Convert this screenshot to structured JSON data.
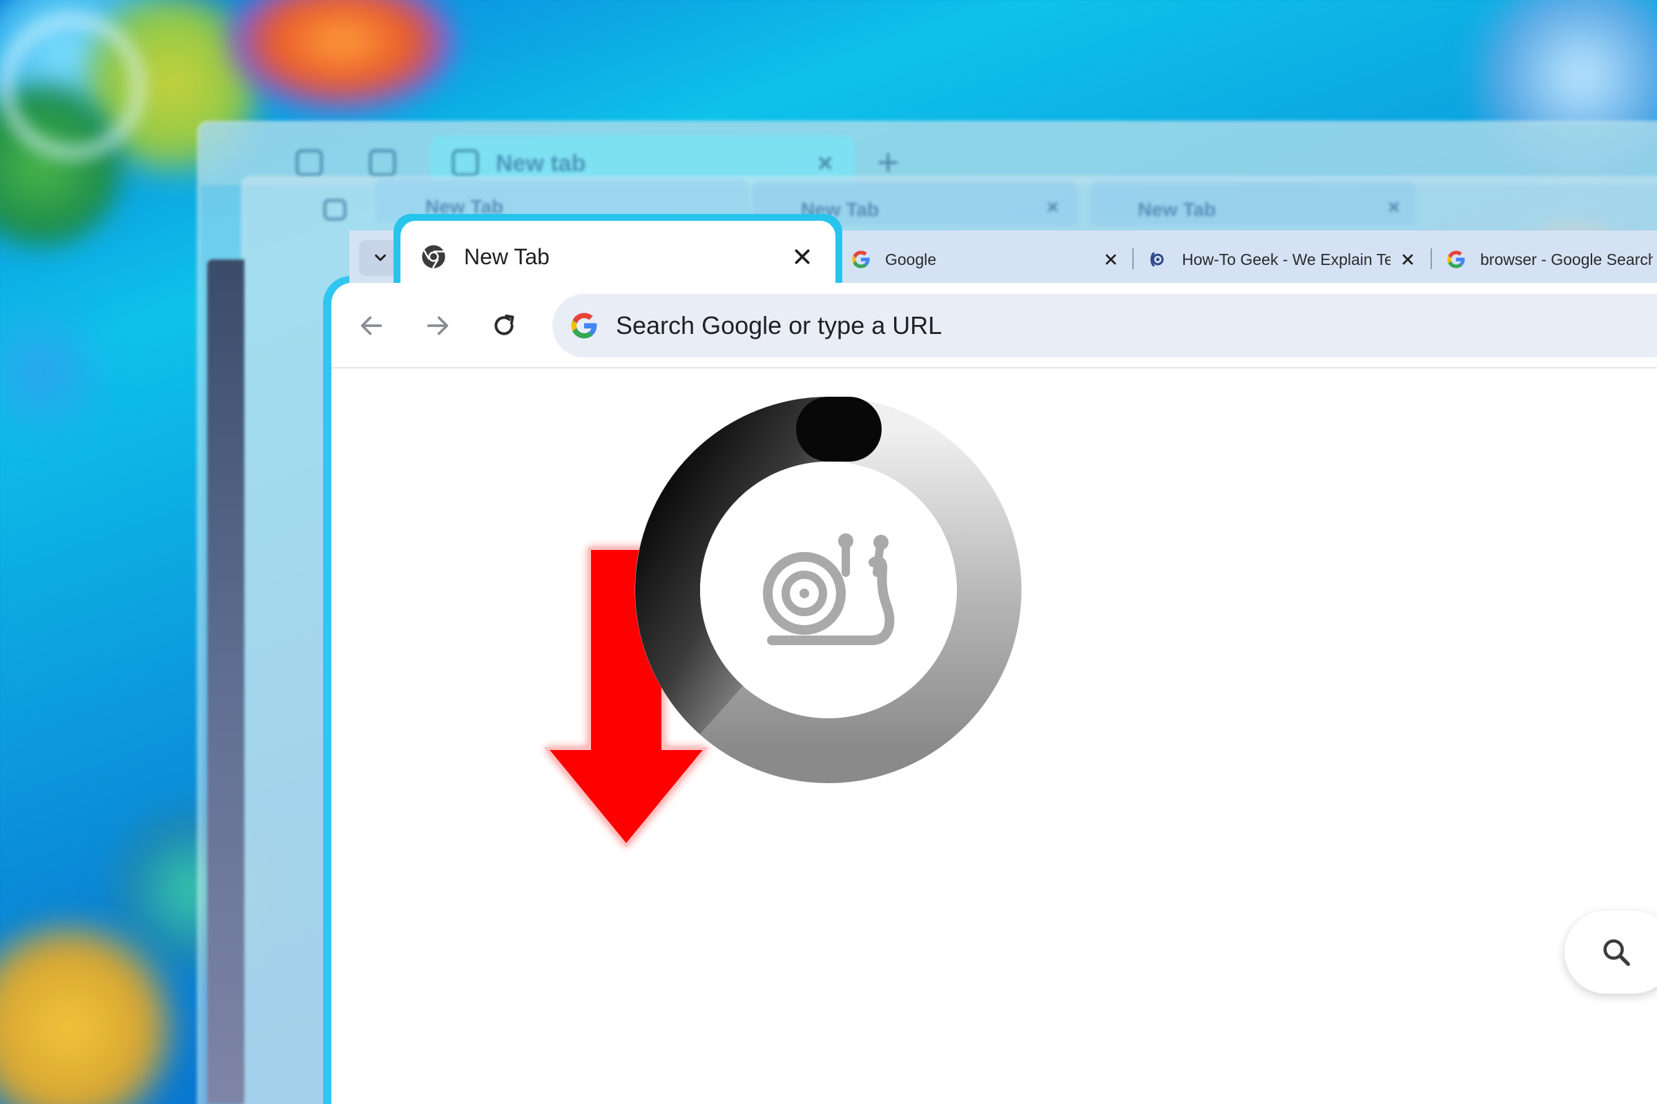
{
  "background_windows": {
    "window1_tab_label": "New tab",
    "window2_tabs": [
      "New Tab",
      "New Tab",
      "New Tab"
    ]
  },
  "tabs": [
    {
      "label": "New Tab",
      "favicon": "chrome-icon",
      "active": true
    },
    {
      "label": "Google",
      "favicon": "google-g-icon",
      "active": false
    },
    {
      "label": "How-To Geek - We Explain Tech",
      "favicon": "htg-icon",
      "active": false
    },
    {
      "label": "browser - Google Search",
      "favicon": "google-g-icon",
      "active": false
    }
  ],
  "toolbar": {
    "back": "back-arrow-icon",
    "forward": "forward-arrow-icon",
    "reload": "reload-icon"
  },
  "omnibox": {
    "placeholder": "Search Google or type a URL",
    "icon": "google-g-icon"
  },
  "overlay": {
    "spinner": "loading-ring",
    "center_icon": "snail-icon",
    "arrow": "down-arrow",
    "arrow_color": "#ff0000"
  },
  "colors": {
    "window_accent": "#2fc6f0",
    "tabstrip": "#d5e2f4",
    "omnibox_bg": "#e9edf6"
  }
}
